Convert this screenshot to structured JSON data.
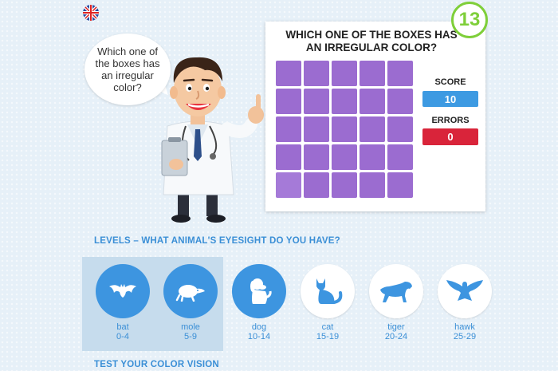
{
  "speech_bubble": "Which one of the boxes has an irregular color?",
  "game": {
    "question": "WHICH ONE OF THE BOXES HAS AN IRREGULAR COLOR?",
    "timer": "13",
    "score_label": "SCORE",
    "score_value": "10",
    "errors_label": "ERRORS",
    "errors_value": "0",
    "grid": {
      "rows": 5,
      "cols": 5,
      "base_color": "#9b6cd0",
      "odd_color": "#a57ad8",
      "odd_row": 5,
      "odd_col": 1
    }
  },
  "levels": {
    "title": "LEVELS – WHAT ANIMAL'S EYESIGHT DO YOU HAVE?",
    "items": [
      {
        "name": "bat",
        "range": "0-4",
        "icon": "bat-icon",
        "active": true
      },
      {
        "name": "mole",
        "range": "5-9",
        "icon": "mole-icon",
        "active": true
      },
      {
        "name": "dog",
        "range": "10-14",
        "icon": "dog-icon",
        "active": false
      },
      {
        "name": "cat",
        "range": "15-19",
        "icon": "cat-icon",
        "active": false
      },
      {
        "name": "tiger",
        "range": "20-24",
        "icon": "tiger-icon",
        "active": false
      },
      {
        "name": "hawk",
        "range": "25-29",
        "icon": "hawk-icon",
        "active": false
      }
    ]
  },
  "test_title": "TEST YOUR COLOR VISION",
  "colors": {
    "accent_blue": "#3d95e0",
    "error_red": "#d9243a",
    "timer_green": "#7fcf3a"
  }
}
